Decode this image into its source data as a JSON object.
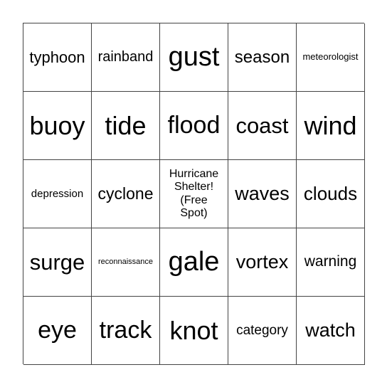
{
  "cells": [
    "typhoon",
    "rainband",
    "gust",
    "season",
    "meteorologist",
    "buoy",
    "tide",
    "flood",
    "coast",
    "wind",
    "depression",
    "cyclone",
    "Hurricane Shelter! (Free Spot)",
    "waves",
    "clouds",
    "surge",
    "reconnaissance",
    "gale",
    "vortex",
    "warning",
    "eye",
    "track",
    "knot",
    "category",
    "watch"
  ]
}
